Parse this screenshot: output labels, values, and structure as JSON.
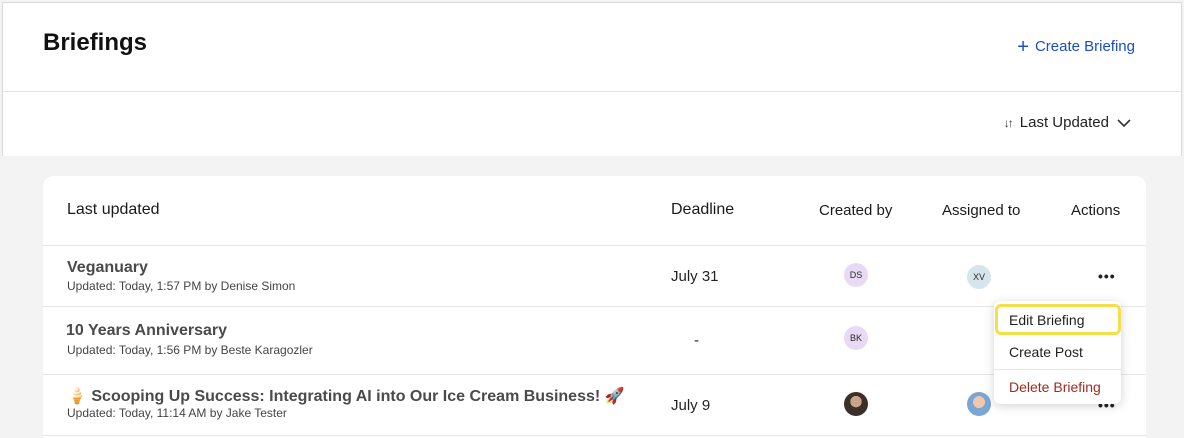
{
  "header": {
    "title": "Briefings",
    "create_label": "Create Briefing"
  },
  "sort": {
    "label": "Last Updated"
  },
  "table": {
    "columns": [
      "Last updated",
      "Deadline",
      "Created by",
      "Assigned to",
      "Actions"
    ],
    "rows": [
      {
        "title": "Veganuary",
        "subtitle": "Updated: Today, 1:57 PM by Denise Simon",
        "deadline": "July 31",
        "created_by": "DS",
        "assigned_to": "XV"
      },
      {
        "title": "10 Years Anniversary",
        "subtitle": "Updated: Today, 1:56 PM by Beste Karagozler",
        "deadline": "-",
        "created_by": "BK",
        "assigned_to": ""
      },
      {
        "title": "🍦 Scooping Up Success: Integrating AI into Our Ice Cream Business! 🚀",
        "subtitle": "Updated: Today, 11:14 AM by Jake Tester",
        "deadline": "July 9",
        "created_by": "",
        "assigned_to": ""
      }
    ],
    "actions_label": "•••"
  },
  "menu": {
    "items": [
      "Edit Briefing",
      "Create Post",
      "Delete Briefing"
    ]
  },
  "icons": {
    "plus": "plus-icon",
    "sort": "sort-icon",
    "chevron": "chevron-down-icon",
    "more": "more-horizontal-icon"
  },
  "colors": {
    "accent": "#1a4fc4",
    "danger": "#a12a1f",
    "highlight": "#f3df4a"
  }
}
